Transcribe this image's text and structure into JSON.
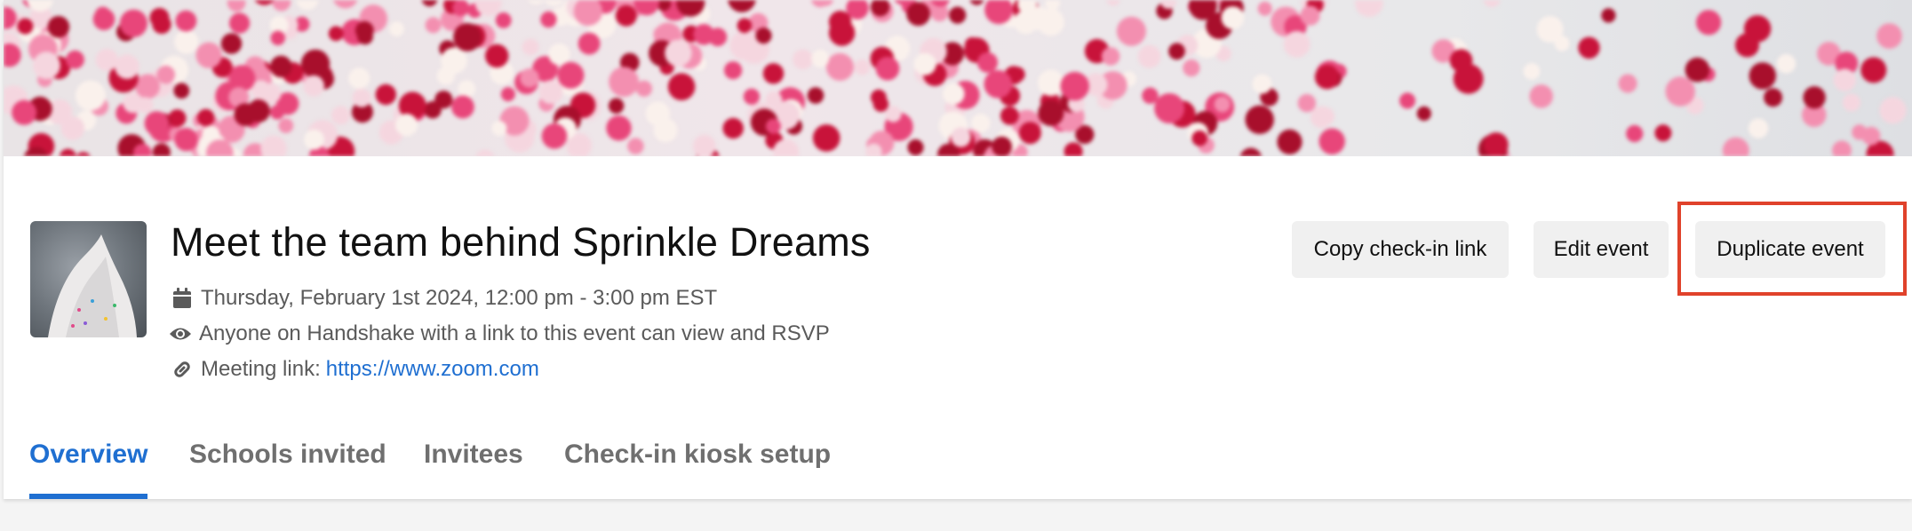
{
  "event": {
    "title": "Meet the team behind Sprinkle Dreams",
    "date_time": "Thursday, February 1st 2024, 12:00 pm - 3:00 pm EST",
    "visibility": "Anyone on Handshake with a link to this event can view and RSVP",
    "meeting_label": "Meeting link:",
    "meeting_url": "https://www.zoom.com"
  },
  "actions": {
    "copy_checkin": "Copy check-in link",
    "edit": "Edit event",
    "duplicate": "Duplicate event"
  },
  "tabs": [
    {
      "label": "Overview",
      "active": true
    },
    {
      "label": "Schools invited",
      "active": false
    },
    {
      "label": "Invitees",
      "active": false
    },
    {
      "label": "Check-in kiosk setup",
      "active": false
    }
  ],
  "icons": {
    "date": "calendar-icon",
    "visibility": "eye-icon",
    "meeting": "link-icon"
  },
  "colors": {
    "accent": "#1f6fd1",
    "highlight": "#e0422b",
    "button_bg": "#f0f0f0"
  }
}
